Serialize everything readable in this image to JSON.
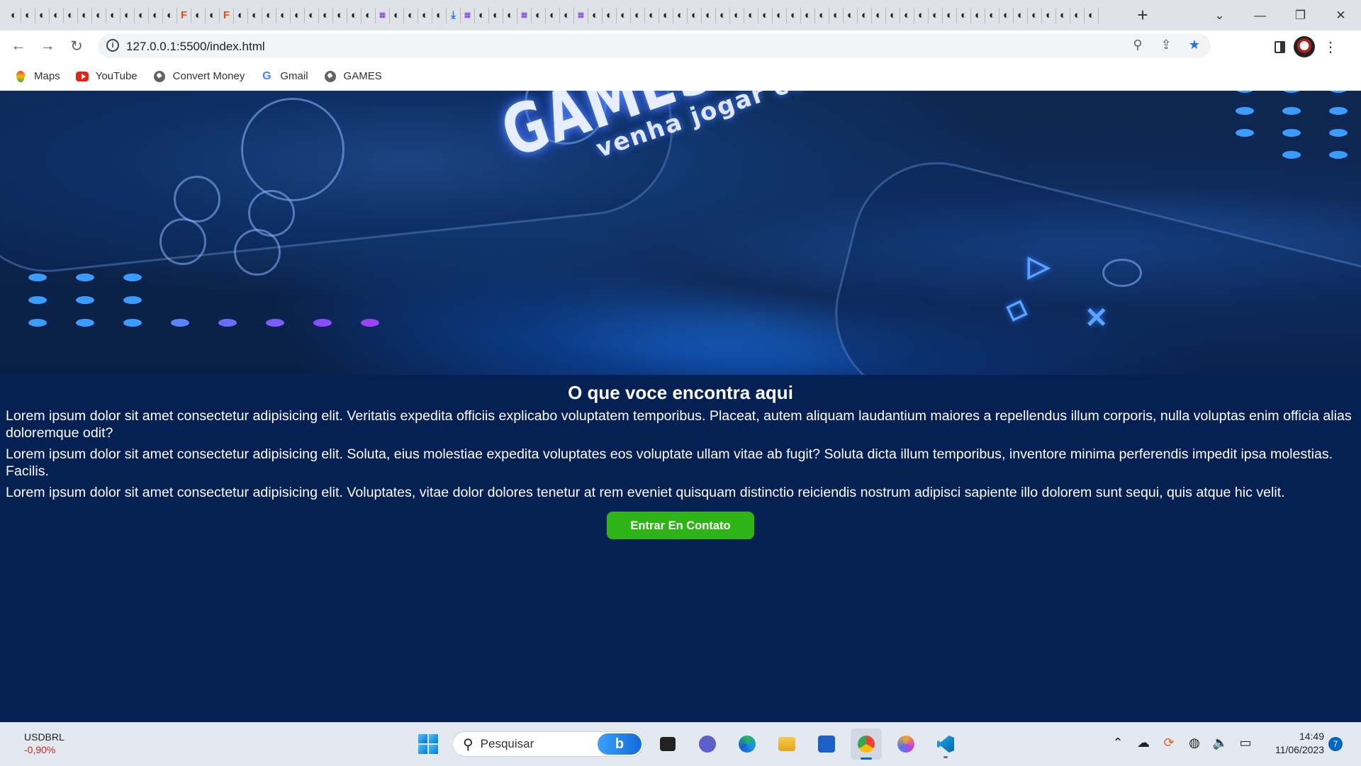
{
  "browser": {
    "url": "127.0.0.1:5500/index.html",
    "window_controls": {
      "minimize": "—",
      "maximize": "❐",
      "close": "✕"
    },
    "bookmarks": [
      {
        "label": "Maps",
        "icon": "maps-icon"
      },
      {
        "label": "YouTube",
        "icon": "youtube-icon"
      },
      {
        "label": "Convert Money",
        "icon": "globe-icon"
      },
      {
        "label": "Gmail",
        "icon": "google-icon"
      },
      {
        "label": "GAMES",
        "icon": "globe-icon"
      }
    ]
  },
  "page": {
    "banner": {
      "title": "GAMES CLUB",
      "subtitle": "venha jogar conosco"
    },
    "section_title": "O que voce encontra aqui",
    "paragraphs": [
      "Lorem ipsum dolor sit amet consectetur adipisicing elit. Veritatis expedita officiis explicabo voluptatem temporibus. Placeat, autem aliquam laudantium maiores a repellendus illum corporis, nulla voluptas enim officia alias doloremque odit?",
      "Lorem ipsum dolor sit amet consectetur adipisicing elit. Soluta, eius molestiae expedita voluptates eos voluptate ullam vitae ab fugit? Soluta dicta illum temporibus, inventore minima perferendis impedit ipsa molestias. Facilis.",
      "Lorem ipsum dolor sit amet consectetur adipisicing elit. Voluptates, vitae dolor dolores tenetur at rem eveniet quisquam distinctio reiciendis nostrum adipisci sapiente illo dolorem sunt sequi, quis atque hic velit."
    ],
    "cta_label": "Entrar En Contato",
    "colors": {
      "background": "#052052",
      "cta": "#2eb416"
    }
  },
  "taskbar": {
    "ticker_symbol": "USDBRL",
    "ticker_change": "-0,90%",
    "search_placeholder": "Pesquisar",
    "time": "14:49",
    "date": "11/06/2023",
    "notification_count": "7"
  }
}
